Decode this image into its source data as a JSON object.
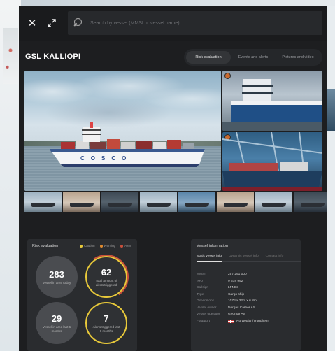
{
  "search": {
    "placeholder": "Search by vessel (MMSI or vessel name)"
  },
  "vessel": {
    "name": "GSL KALLIOPI"
  },
  "tabs": [
    {
      "label": "Risk evaluation",
      "active": true
    },
    {
      "label": "Events and alerts",
      "active": false
    },
    {
      "label": "Pictures and video",
      "active": false
    }
  ],
  "gallery": {
    "ship_hull_text": "COSCO",
    "thumbnail_count": 8
  },
  "risk": {
    "title": "Risk evaluation",
    "legend": [
      {
        "label": "Caution",
        "color": "#e8c93a"
      },
      {
        "label": "Warning",
        "color": "#e08a2e"
      },
      {
        "label": "Alert",
        "color": "#c9503c"
      }
    ],
    "stats": [
      {
        "value": "283",
        "label": "Vessel in area today"
      },
      {
        "value": "62",
        "label": "Total amount of alerts triggered"
      },
      {
        "value": "29",
        "label": "Vessel in area last 6 months"
      },
      {
        "value": "7",
        "label": "Alerts triggered last 6 months"
      }
    ]
  },
  "vessel_info": {
    "title": "Vessel information",
    "tabs": [
      {
        "label": "Static vessel info",
        "active": true
      },
      {
        "label": "Dynamic vessel info",
        "active": false
      },
      {
        "label": "Contact info",
        "active": false
      }
    ],
    "rows": [
      {
        "key": "MMSI",
        "value": "257 291 000"
      },
      {
        "key": "IMO",
        "value": "9 678 992"
      },
      {
        "key": "Callsign",
        "value": "LFNE3"
      },
      {
        "key": "Type",
        "value": "Cargo ship"
      },
      {
        "key": "Dimensions",
        "value": "107mx 22m x 6.8m"
      },
      {
        "key": "Vessel owner",
        "value": "Norgas Carrier AS"
      },
      {
        "key": "Vessel operator",
        "value": "Geomar AS"
      },
      {
        "key": "Flag/port",
        "value": "Norwegian/Trondheim"
      }
    ]
  },
  "colors": {
    "panel": "#1d1e20",
    "card": "#2a2c2f",
    "caution": "#e8c93a",
    "alert": "#c9503c"
  },
  "icons": {
    "close": "close-icon",
    "expand": "expand-icon",
    "search": "search-icon",
    "flag": "norway-flag-icon"
  }
}
